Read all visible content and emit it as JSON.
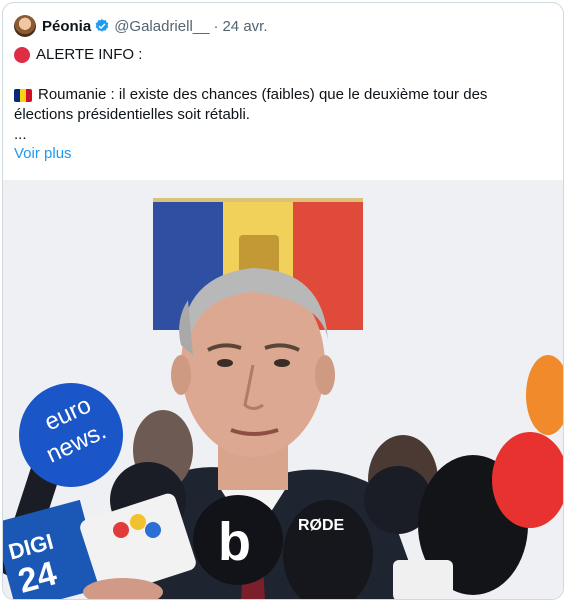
{
  "tweet": {
    "author_name": "Péonia",
    "handle": "@Galadriell__",
    "separator": "·",
    "date": "24 avr.",
    "line1": "ALERTE INFO :",
    "line2": "Roumanie : il existe des chances (faibles) que le deuxième tour des",
    "line3": "élections présidentielles soit rétabli.",
    "line4": "...",
    "show_more": "Voir plus"
  },
  "icons": {
    "verified": "verified-badge-icon",
    "alert": "red-circle-icon",
    "flag": "romania-flag-icon"
  },
  "colors": {
    "accent": "#1d9bf0",
    "muted": "#536471",
    "alert_red": "#dd2e44",
    "flag_blue": "#002b7f",
    "flag_yellow": "#fcd116",
    "flag_red": "#ce1126"
  },
  "media": {
    "mic_labels": {
      "euronews_1": "euro",
      "euronews_2": "news.",
      "digi": "DIGI",
      "digi_num": "24",
      "b1": "b",
      "rode": "RØDE"
    }
  }
}
